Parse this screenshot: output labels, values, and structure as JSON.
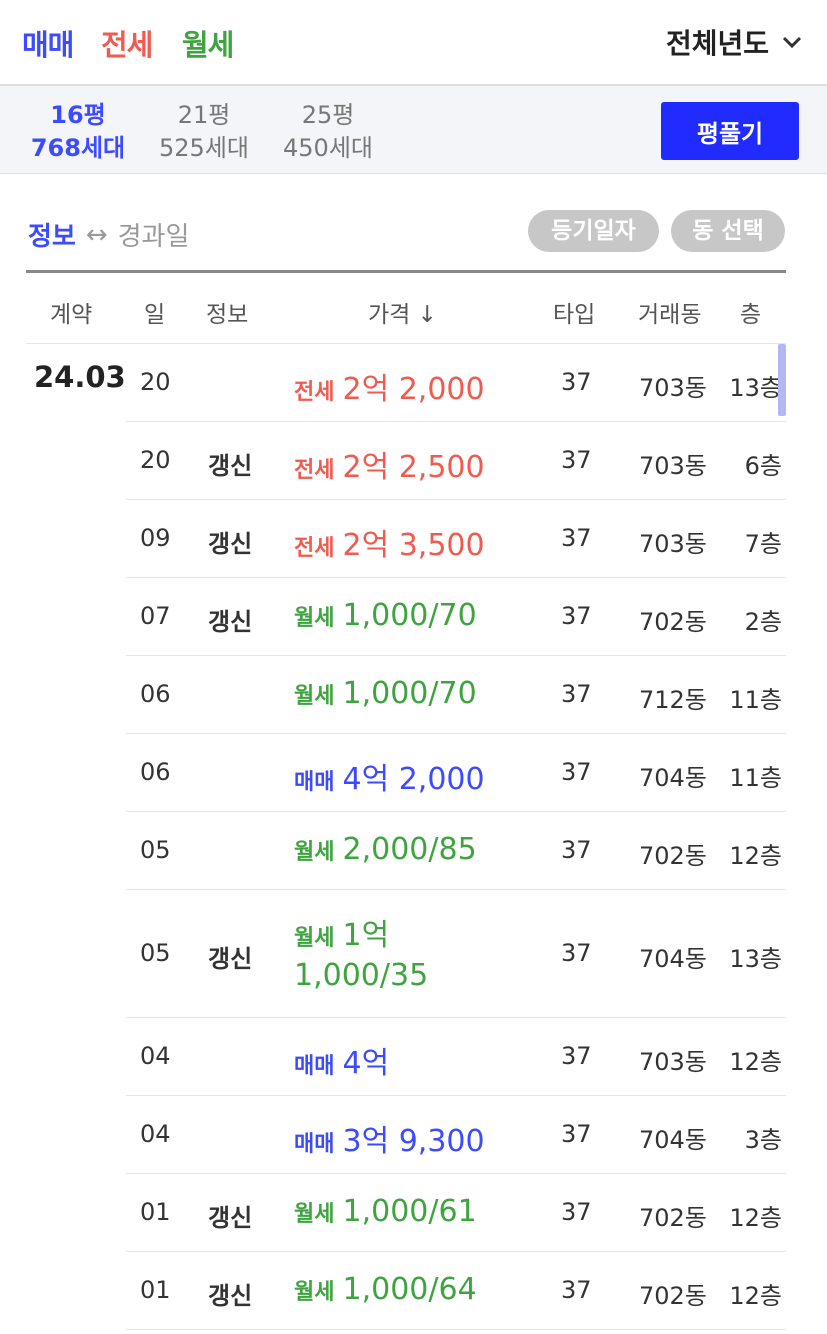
{
  "filters": {
    "deal_types": [
      "매매",
      "전세",
      "월세"
    ],
    "year": "전체년도"
  },
  "sizes": [
    {
      "pyeong": "16평",
      "households": "768세대",
      "active": true
    },
    {
      "pyeong": "21평",
      "households": "525세대",
      "active": false
    },
    {
      "pyeong": "25평",
      "households": "450세대",
      "active": false
    }
  ],
  "pyeong_button": "평풀기",
  "info_toggle": {
    "on": "정보",
    "arrow": "↔",
    "off": "경과일"
  },
  "pills": {
    "registry": "등기일자",
    "dong": "동 선택"
  },
  "table": {
    "headers": {
      "contract": "계약",
      "day": "일",
      "info": "정보",
      "price": "가격",
      "type": "타입",
      "dong": "거래동",
      "floor": "층"
    },
    "sort_indicator": "↓",
    "month": "24.03",
    "rows": [
      {
        "day": "20",
        "info": "",
        "kind": "전세",
        "price": "2억 2,000",
        "price2": "",
        "type": "37",
        "dong": "703동",
        "floor": "13층"
      },
      {
        "day": "20",
        "info": "갱신",
        "kind": "전세",
        "price": "2억 2,500",
        "price2": "",
        "type": "37",
        "dong": "703동",
        "floor": "6층"
      },
      {
        "day": "09",
        "info": "갱신",
        "kind": "전세",
        "price": "2억 3,500",
        "price2": "",
        "type": "37",
        "dong": "703동",
        "floor": "7층"
      },
      {
        "day": "07",
        "info": "갱신",
        "kind": "월세",
        "price": "1,000/70",
        "price2": "",
        "type": "37",
        "dong": "702동",
        "floor": "2층"
      },
      {
        "day": "06",
        "info": "",
        "kind": "월세",
        "price": "1,000/70",
        "price2": "",
        "type": "37",
        "dong": "712동",
        "floor": "11층"
      },
      {
        "day": "06",
        "info": "",
        "kind": "매매",
        "price": "4억 2,000",
        "price2": "",
        "type": "37",
        "dong": "704동",
        "floor": "11층"
      },
      {
        "day": "05",
        "info": "",
        "kind": "월세",
        "price": "2,000/85",
        "price2": "",
        "type": "37",
        "dong": "702동",
        "floor": "12층"
      },
      {
        "day": "05",
        "info": "갱신",
        "kind": "월세",
        "price": "1억",
        "price2": "1,000/35",
        "type": "37",
        "dong": "704동",
        "floor": "13층"
      },
      {
        "day": "04",
        "info": "",
        "kind": "매매",
        "price": "4억",
        "price2": "",
        "type": "37",
        "dong": "703동",
        "floor": "12층"
      },
      {
        "day": "04",
        "info": "",
        "kind": "매매",
        "price": "3억 9,300",
        "price2": "",
        "type": "37",
        "dong": "704동",
        "floor": "3층"
      },
      {
        "day": "01",
        "info": "갱신",
        "kind": "월세",
        "price": "1,000/61",
        "price2": "",
        "type": "37",
        "dong": "702동",
        "floor": "12층"
      },
      {
        "day": "01",
        "info": "갱신",
        "kind": "월세",
        "price": "1,000/64",
        "price2": "",
        "type": "37",
        "dong": "702동",
        "floor": "12층"
      }
    ]
  },
  "colors": {
    "sale": "#3d4bff",
    "jeonse": "#f05a4f",
    "wolse": "#3fa43f",
    "button": "#1f2bff"
  }
}
